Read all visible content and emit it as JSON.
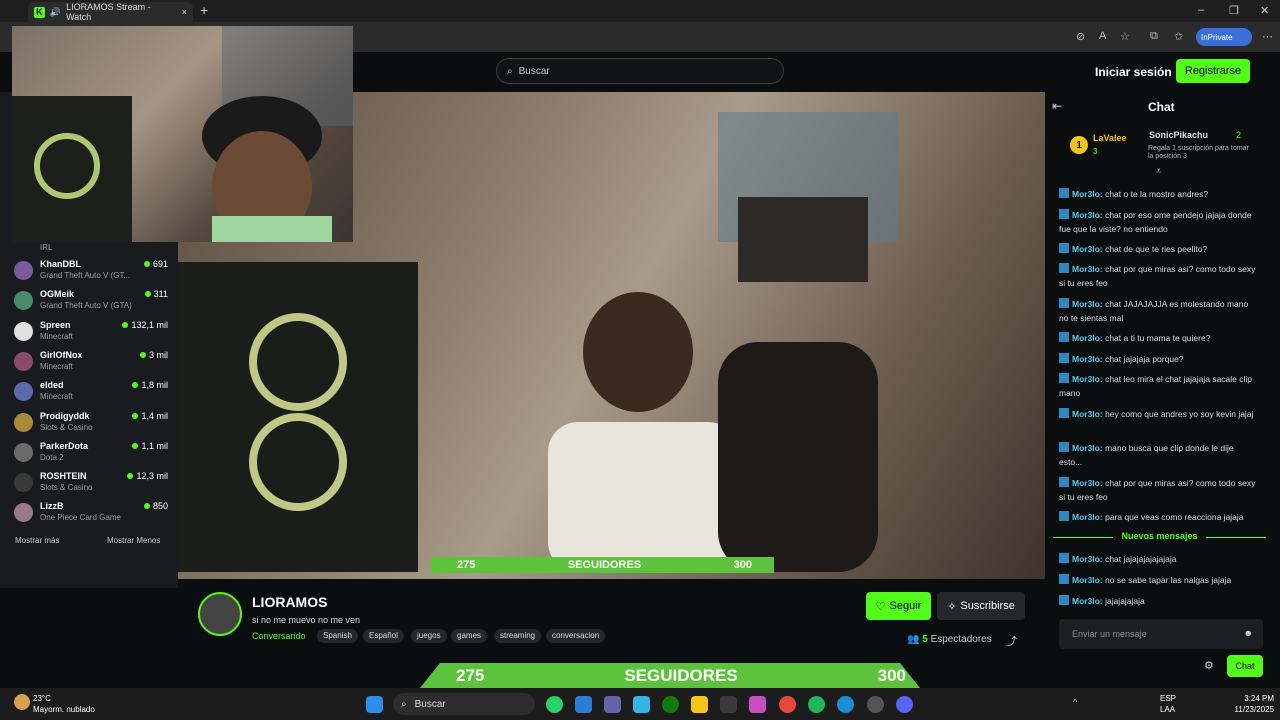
{
  "browser": {
    "tab_title": "LIORAMOS Stream - Watch",
    "inprivate_label": "InPrivate"
  },
  "site": {
    "search_placeholder": "Buscar",
    "login_label": "Iniciar sesión",
    "register_label": "Registrarse"
  },
  "sidebar": {
    "irl_label": "IRL",
    "items": [
      {
        "name": "KhanDBL",
        "category": "Grand Theft Auto V (GT...",
        "viewers": "691"
      },
      {
        "name": "OGMeik",
        "category": "Grand Theft Auto V (GTA)",
        "viewers": "311"
      },
      {
        "name": "Spreen",
        "category": "Minecraft",
        "viewers": "132,1 mil"
      },
      {
        "name": "GirlOfNox",
        "category": "Minecraft",
        "viewers": "3 mil"
      },
      {
        "name": "elded",
        "category": "Minecraft",
        "viewers": "1,8 mil"
      },
      {
        "name": "Prodigyddk",
        "category": "Slots & Casino",
        "viewers": "1,4 mil"
      },
      {
        "name": "ParkerDota",
        "category": "Dota 2",
        "viewers": "1,1 mil"
      },
      {
        "name": "ROSHTEIN",
        "category": "Slots & Casino",
        "viewers": "12,3 mil"
      },
      {
        "name": "LizzB",
        "category": "One Piece Card Game",
        "viewers": "850"
      }
    ],
    "show_more": "Mostrar más",
    "show_less": "Mostrar Menos"
  },
  "video": {
    "goal_current": "275",
    "goal_label": "SEGUIDORES",
    "goal_target": "300",
    "goal_progress": 0.917
  },
  "channel": {
    "name": "LIORAMOS",
    "title": "si no me muevo no me ven",
    "category": "Conversando",
    "tags": [
      "Spanish",
      "Español",
      "juegos",
      "games",
      "streaming",
      "conversacion"
    ],
    "follow_label": "Seguir",
    "subscribe_label": "Suscribirse",
    "viewers_count": "5",
    "viewers_label": "Espectadores"
  },
  "chat": {
    "title": "Chat",
    "gifters": [
      {
        "rank": "1",
        "name": "LaValee",
        "count": "3"
      },
      {
        "name": "SonicPikachu",
        "count": "2"
      }
    ],
    "gift_note": "Regala 1 suscripción para tomar la posición 3",
    "messages": [
      {
        "user": "Mor3lo:",
        "text": "chat o te la mostro andres?"
      },
      {
        "user": "Mor3lo:",
        "text": "chat por eso ome pendejo jajaja donde fue que la viste? no entiendo"
      },
      {
        "user": "Mor3lo:",
        "text": "chat de que te ries peelito?"
      },
      {
        "user": "Mor3lo:",
        "text": "chat por que miras asi? como todo sexy si tu eres feo"
      },
      {
        "user": "Mor3lo:",
        "text": "chat JAJAJAJJA es molestando mano no te sientas mal"
      },
      {
        "user": "Mor3lo:",
        "text": "chat a ti tu mama te quiere?"
      },
      {
        "user": "Mor3lo:",
        "text": "chat jajajaja porque?"
      },
      {
        "user": "Mor3lo:",
        "text": "chat leo mira el chat jajajaja sacale clip mano"
      },
      {
        "user": "Mor3lo:",
        "text": "hey como que andres yo soy kevin jajaj"
      },
      {
        "user": "Mor3lo:",
        "text": "mano busca que clip donde le dije esto..."
      },
      {
        "user": "Mor3lo:",
        "text": "chat por que miras asi? como todo sexy si tu eres feo"
      },
      {
        "user": "Mor3lo:",
        "text": "para que veas como reacciona jajaja"
      }
    ],
    "new_messages_label": "Nuevos mensajes",
    "new_messages": [
      {
        "user": "Mor3lo:",
        "text": "chat jajajajajajajaja"
      },
      {
        "user": "Mor3lo:",
        "text": "no se sabe tapar las nalgas jajaja"
      },
      {
        "user": "Mor3lo:",
        "text": "jajajajajaja"
      }
    ],
    "input_placeholder": "Enviar un mensaje",
    "send_label": "Chat"
  },
  "taskbar": {
    "temperature": "23°C",
    "weather": "Mayorm. nublado",
    "search_label": "Buscar",
    "lang_top": "ESP",
    "lang_bottom": "LAA",
    "time": "3:24 PM",
    "date": "11/23/2025"
  },
  "colors": {
    "accent": "#53fc18",
    "goal_bar": "#5dc33c",
    "chat_user": "#5ec8f0"
  }
}
